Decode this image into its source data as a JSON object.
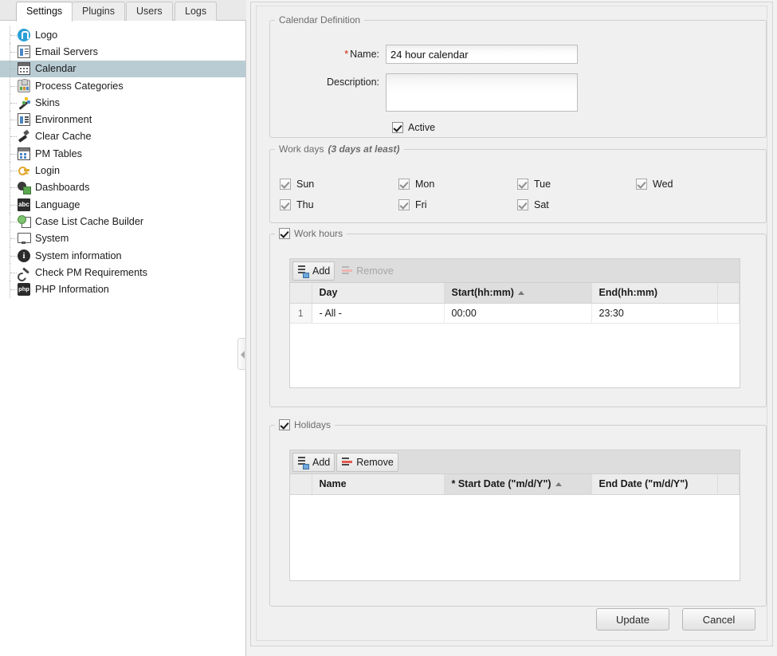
{
  "tabs": [
    {
      "label": "Settings",
      "active": true
    },
    {
      "label": "Plugins",
      "active": false
    },
    {
      "label": "Users",
      "active": false
    },
    {
      "label": "Logs",
      "active": false
    }
  ],
  "sidebar": {
    "items": [
      {
        "label": "Logo",
        "icon": "logo-icon",
        "selected": false
      },
      {
        "label": "Email Servers",
        "icon": "email-servers-icon",
        "selected": false
      },
      {
        "label": "Calendar",
        "icon": "calendar-icon",
        "selected": true
      },
      {
        "label": "Process Categories",
        "icon": "process-categories-icon",
        "selected": false
      },
      {
        "label": "Skins",
        "icon": "skins-icon",
        "selected": false
      },
      {
        "label": "Environment",
        "icon": "environment-icon",
        "selected": false
      },
      {
        "label": "Clear Cache",
        "icon": "clear-cache-icon",
        "selected": false
      },
      {
        "label": "PM Tables",
        "icon": "pm-tables-icon",
        "selected": false
      },
      {
        "label": "Login",
        "icon": "login-key-icon",
        "selected": false
      },
      {
        "label": "Dashboards",
        "icon": "dashboards-icon",
        "selected": false
      },
      {
        "label": "Language",
        "icon": "language-abc-icon",
        "selected": false
      },
      {
        "label": "Case List Cache Builder",
        "icon": "case-list-cache-builder-icon",
        "selected": false
      },
      {
        "label": "System",
        "icon": "system-monitor-icon",
        "selected": false
      },
      {
        "label": "System information",
        "icon": "info-icon",
        "selected": false
      },
      {
        "label": "Check PM Requirements",
        "icon": "wrench-icon",
        "selected": false
      },
      {
        "label": "PHP Information",
        "icon": "php-icon",
        "selected": false
      }
    ]
  },
  "definition": {
    "legend": "Calendar Definition",
    "name_label": "Name:",
    "name_required_mark": "*",
    "name_value": "24 hour calendar",
    "description_label": "Description:",
    "description_value": "",
    "active_label": "Active",
    "active_checked": true
  },
  "workdays": {
    "legend": "Work days",
    "legend_note": "(3 days at least)",
    "days": [
      {
        "label": "Sun",
        "checked": true
      },
      {
        "label": "Mon",
        "checked": true
      },
      {
        "label": "Tue",
        "checked": true
      },
      {
        "label": "Wed",
        "checked": true
      },
      {
        "label": "Thu",
        "checked": true
      },
      {
        "label": "Fri",
        "checked": true
      },
      {
        "label": "Sat",
        "checked": true
      }
    ]
  },
  "workhours": {
    "legend": "Work hours",
    "enabled": true,
    "toolbar": {
      "add_label": "Add",
      "remove_label": "Remove",
      "add_enabled": true,
      "remove_enabled": false
    },
    "columns": [
      {
        "label": "Day",
        "sorted": false
      },
      {
        "label": "Start(hh:mm)",
        "sorted": true,
        "sort_dir": "asc"
      },
      {
        "label": "End(hh:mm)",
        "sorted": false
      }
    ],
    "rows": [
      {
        "num": "1",
        "day": "- All -",
        "start": "00:00",
        "end": "23:30"
      }
    ]
  },
  "holidays": {
    "legend": "Holidays",
    "enabled": true,
    "toolbar": {
      "add_label": "Add",
      "remove_label": "Remove",
      "add_enabled": true,
      "remove_enabled": true
    },
    "columns": [
      {
        "label": "Name",
        "sorted": false
      },
      {
        "label": "* Start Date (\"m/d/Y\")",
        "sorted": true,
        "sort_dir": "asc"
      },
      {
        "label": "End Date (\"m/d/Y\")",
        "sorted": false
      }
    ],
    "rows": []
  },
  "footer": {
    "update_label": "Update",
    "cancel_label": "Cancel"
  },
  "colors": {
    "selection": "#b9ccd4",
    "required": "#cc2200",
    "panel_bg": "#f0f0f0",
    "grid_header": "#ececec",
    "grid_header_sorted": "#dedede"
  }
}
